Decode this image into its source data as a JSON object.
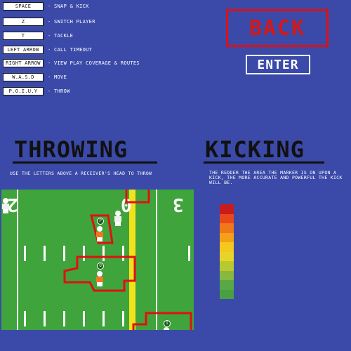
{
  "controls": [
    {
      "key": "SPACE",
      "action": "- SNAP & KICK"
    },
    {
      "key": "Z",
      "action": "- SWITCH PLAYER"
    },
    {
      "key": "T",
      "action": "- TACKLE"
    },
    {
      "key": "LEFT ARROW",
      "action": "- CALL TIMEOUT"
    },
    {
      "key": "RIGHT ARROW",
      "action": "- VIEW PLAY COVERAGE & ROUTES"
    },
    {
      "key": "W.A.S.D",
      "action": "- MOVE"
    },
    {
      "key": "P.O.I.U.Y",
      "action": "- THROW"
    }
  ],
  "buttons": {
    "back": "BACK",
    "enter": "ENTER"
  },
  "throwing": {
    "title": "THROWING",
    "caption": "USE THE LETTERS ABOVE A RECEIVER'S HEAD TO THROW",
    "field": {
      "yard_numbers": [
        "2",
        "0",
        "3"
      ],
      "receiver_letters": [
        "P",
        "O",
        "I"
      ]
    }
  },
  "kicking": {
    "title": "KICKING",
    "caption": "THE REDDER THE AREA THE MARKER IS ON UPON A KICK, THE MORE ACCURATE AND POWERFUL THE KICK WILL BE.",
    "meter_colors": [
      "#c81c1c",
      "#e8481c",
      "#f07818",
      "#f4a018",
      "#f4c81c",
      "#e8d428",
      "#b8c830",
      "#88b840",
      "#58a848",
      "#48a040"
    ]
  },
  "colors": {
    "background": "#3b4aa8",
    "field": "#3fa43b",
    "route": "#e01010",
    "goal_line": "#f2e21c"
  }
}
